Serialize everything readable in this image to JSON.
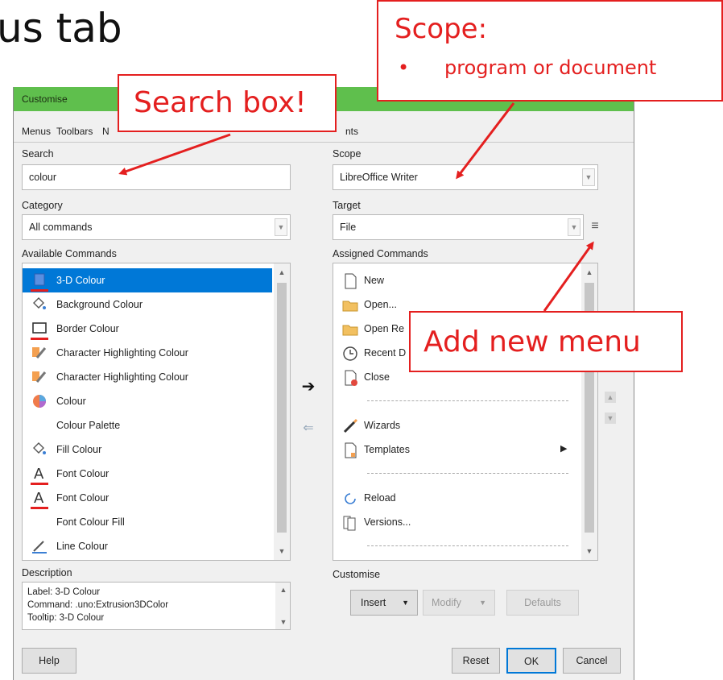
{
  "slide": {
    "title_fragment": "us tab"
  },
  "dialog": {
    "title": "Customise",
    "tabs": [
      {
        "label": "Menus"
      },
      {
        "label": "Toolbars"
      },
      {
        "label": "N"
      },
      {
        "label": "nts"
      }
    ],
    "search": {
      "label": "Search",
      "value": "colour"
    },
    "category": {
      "label": "Category",
      "value": "All commands"
    },
    "available": {
      "label": "Available Commands",
      "items": [
        {
          "label": "3-D Colour",
          "icon": "cube-icon",
          "selected": true
        },
        {
          "label": "Background Colour",
          "icon": "paint-bucket-icon"
        },
        {
          "label": "Border Colour",
          "icon": "border-icon"
        },
        {
          "label": "Character Highlighting Colour",
          "icon": "highlighter-icon"
        },
        {
          "label": "Character Highlighting Colour",
          "icon": "highlighter-icon"
        },
        {
          "label": "Colour",
          "icon": "colour-wheel-icon"
        },
        {
          "label": "Colour Palette",
          "icon": ""
        },
        {
          "label": "Fill Colour",
          "icon": "paint-bucket-icon"
        },
        {
          "label": "Font Colour",
          "icon": "font-colour-icon"
        },
        {
          "label": "Font Colour",
          "icon": "font-colour-icon"
        },
        {
          "label": "Font Colour Fill",
          "icon": ""
        },
        {
          "label": "Line Colour",
          "icon": "line-colour-icon"
        }
      ]
    },
    "scope": {
      "label": "Scope",
      "value": "LibreOffice Writer"
    },
    "target": {
      "label": "Target",
      "value": "File"
    },
    "assigned": {
      "label": "Assigned Commands",
      "items": [
        {
          "label": "New",
          "icon": "new-document-icon"
        },
        {
          "label": "Open...",
          "icon": "folder-icon"
        },
        {
          "label": "Open Re",
          "icon": "folder-icon"
        },
        {
          "label": "Recent D",
          "icon": "clock-icon"
        },
        {
          "label": "Close",
          "icon": "close-document-icon"
        },
        {
          "label": "",
          "separator": true
        },
        {
          "label": "Wizards",
          "icon": "wand-icon"
        },
        {
          "label": "Templates",
          "icon": "template-icon",
          "submenu": true
        },
        {
          "label": "",
          "separator": true
        },
        {
          "label": "Reload",
          "icon": "reload-icon"
        },
        {
          "label": "Versions...",
          "icon": "versions-icon"
        },
        {
          "label": "",
          "separator": true
        }
      ]
    },
    "description": {
      "label": "Description",
      "lines": [
        "Label: 3-D Colour",
        "Command: .uno:Extrusion3DColor",
        "Tooltip: 3-D Colour"
      ]
    },
    "customise": {
      "label": "Customise",
      "insert_label": "Insert",
      "modify_label": "Modify",
      "defaults_label": "Defaults"
    },
    "footer": {
      "help": "Help",
      "reset": "Reset",
      "ok": "OK",
      "cancel": "Cancel"
    }
  },
  "callouts": {
    "scope": {
      "title": "Scope:",
      "bullet": "•",
      "text": "program or document"
    },
    "search": {
      "text": "Search box!"
    },
    "menu": {
      "text": "Add new menu"
    }
  },
  "colors": {
    "accent": "#e41f1f",
    "selection": "#0078d7",
    "titlebar": "#5fbf4d"
  }
}
